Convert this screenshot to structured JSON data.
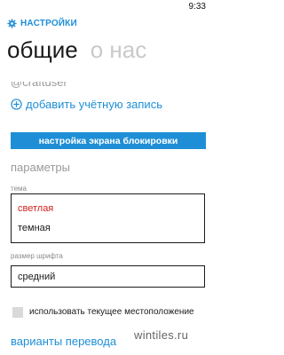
{
  "status_bar": {
    "time": "9:33"
  },
  "app": {
    "title": "НАСТРОЙКИ"
  },
  "pivot": {
    "active": "общие",
    "inactive": "о нас"
  },
  "account": {
    "handle": "@craftuser",
    "add_label": "добавить учётную запись"
  },
  "lock_screen_button": "настройка экрана блокировки",
  "parameters": {
    "title": "параметры",
    "theme": {
      "label": "тема",
      "options": [
        "светлая",
        "темная"
      ],
      "selected": "светлая"
    },
    "font_size": {
      "label": "размер шрифта",
      "value": "средний"
    },
    "location": {
      "label": "использовать текущее местоположение",
      "checked": false
    }
  },
  "translation_link": "варианты перевода",
  "watermark": "wintiles.ru",
  "colors": {
    "accent": "#1e8fd6",
    "selected_option": "#d62020",
    "background": "#ffffff"
  }
}
